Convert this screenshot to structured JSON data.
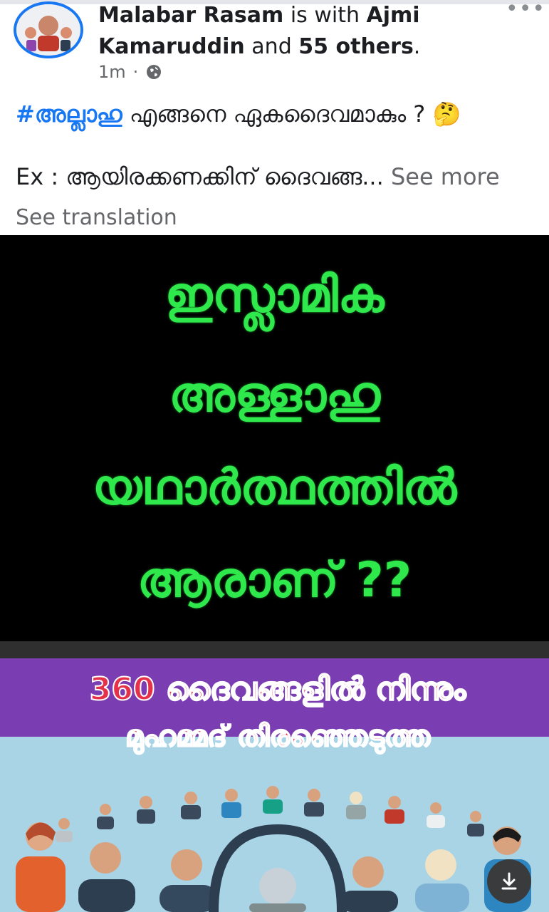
{
  "post": {
    "author": "Malabar Rasam",
    "with_text": "is with",
    "tagged": "Ajmi Kamaruddin",
    "and_text": "and",
    "others": "55 others",
    "period": ".",
    "time": "1m",
    "separator": "·",
    "hashtag": "#അല്ലാഹു",
    "line1_rest": "എങ്ങനെ ഏകദൈവമാകും ? 🤔",
    "line2": "Ex : ആയിരക്കണക്കിന് ദൈവങ്ങ...",
    "see_more": "See more",
    "see_translation": "See translation",
    "more_icon": "•••"
  },
  "image": {
    "lines": [
      "ഇസ്ലാമിക",
      "അള്ളാഹു",
      "യഥാർത്ഥത്തിൽ",
      "ആരാണ് ??"
    ],
    "banner_line1": "360 ദൈവങ്ങളിൽ നിന്നും",
    "banner_line2": "മുഹമ്മദ് തിരഞ്ഞെടുത്ത"
  },
  "colors": {
    "link": "#1877f2",
    "green_text": "#2ee84c",
    "purple": "#7b3db2",
    "banner_red": "#e6314b",
    "sky": "#a9d4e6"
  },
  "icons": {
    "globe": "globe-icon",
    "more": "more-options-icon",
    "download": "download-icon"
  }
}
